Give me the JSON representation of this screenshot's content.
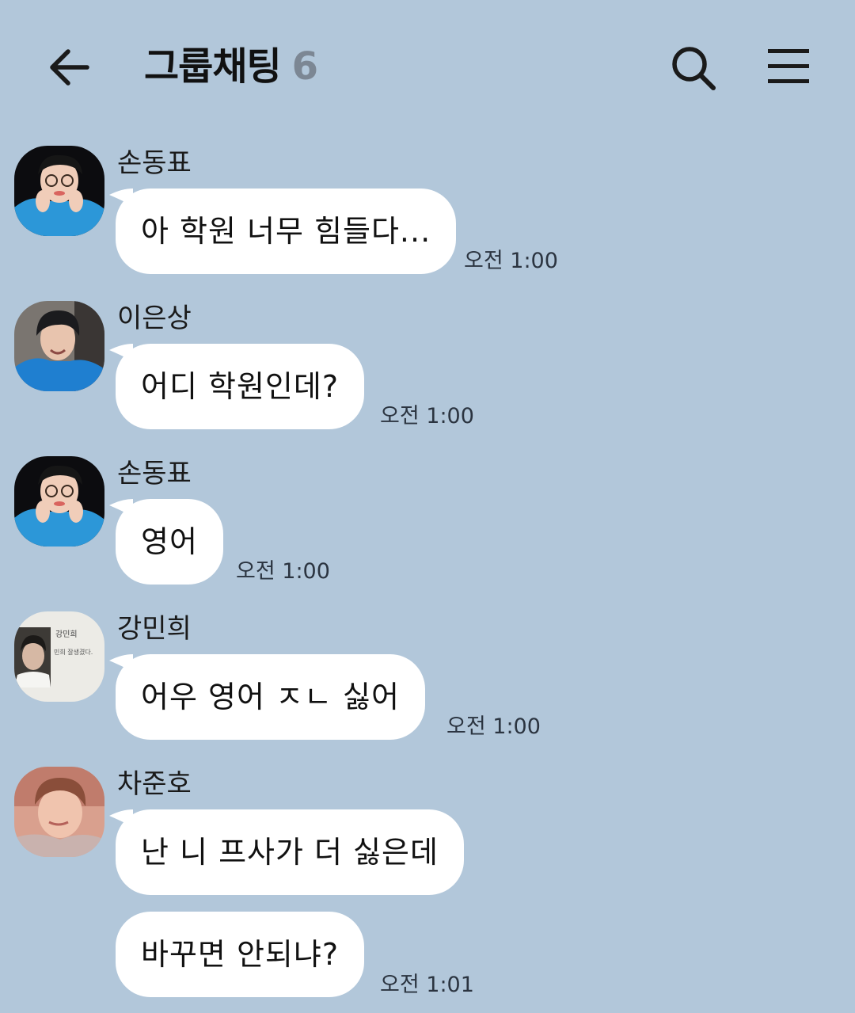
{
  "header": {
    "title": "그룹채팅",
    "member_count": "6"
  },
  "messages": [
    {
      "sender": "손동표",
      "text": "아 학원 너무 힘들다...",
      "time": "오전 1:00"
    },
    {
      "sender": "이은상",
      "text": "어디 학원인데?",
      "time": "오전 1:00"
    },
    {
      "sender": "손동표",
      "text": "영어",
      "time": "오전 1:00"
    },
    {
      "sender": "강민희",
      "text": "어우 영어 ㅈㄴ 싫어",
      "time": "오전 1:00",
      "avatar_text": [
        "강민희",
        "민희 잘생겼다."
      ]
    },
    {
      "sender": "차준호",
      "text": "난 니 프사가 더 싫은데"
    },
    {
      "text": "바꾸면 안되냐?",
      "time": "오전 1:01"
    }
  ],
  "colors": {
    "background": "#b2c7da",
    "bubble": "#ffffff",
    "member_count": "#7c8794",
    "timestamp": "#2b3440"
  },
  "icons": {
    "back": "arrow-left-icon",
    "search": "search-icon",
    "menu": "hamburger-menu-icon"
  }
}
